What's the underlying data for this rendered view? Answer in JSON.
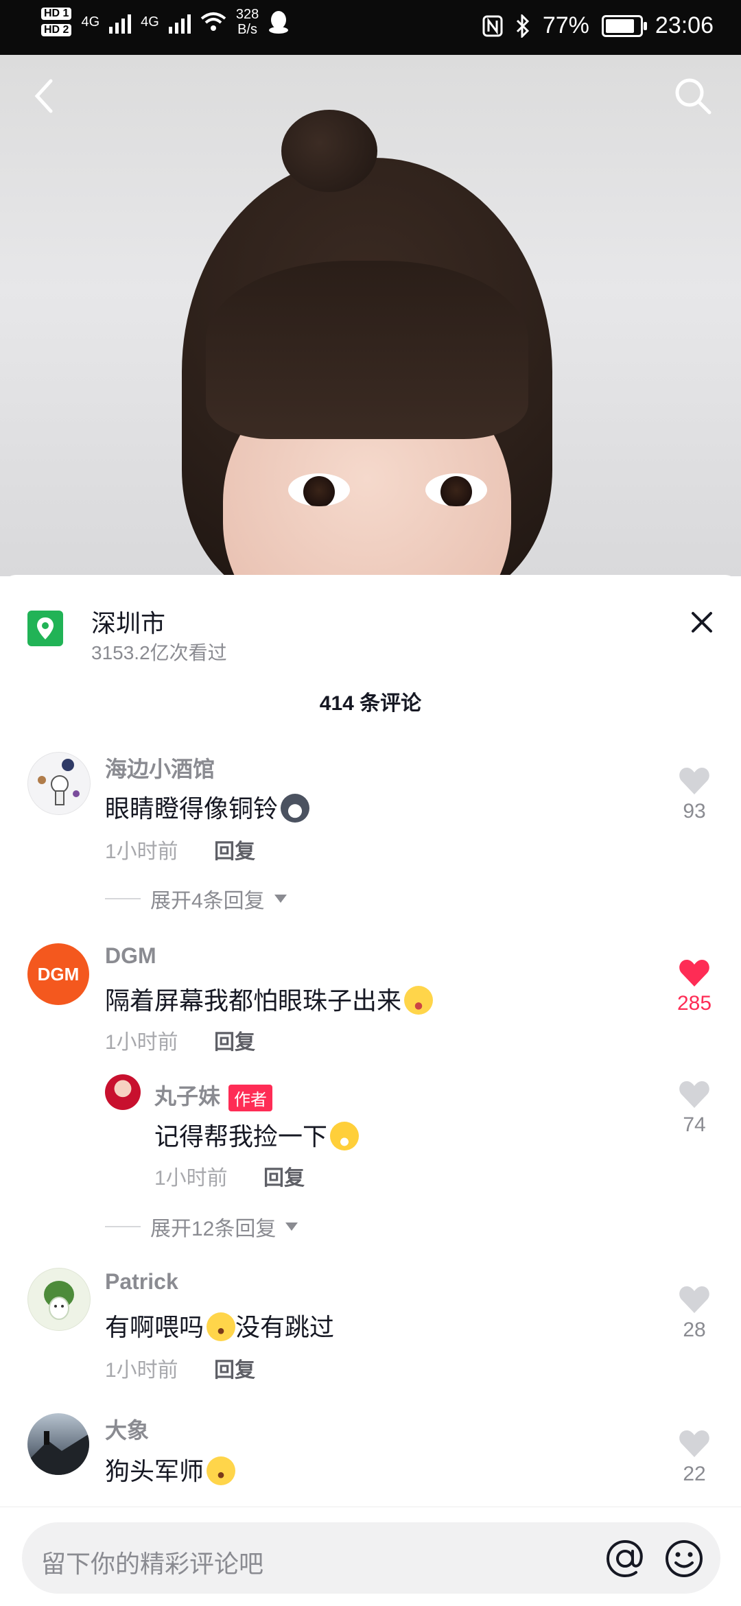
{
  "status_bar": {
    "net_speed": "328",
    "net_unit": "B/s",
    "battery": "77%",
    "time": "23:06",
    "sim1": "HD 1",
    "sim2": "HD 2",
    "net1": "4G",
    "net2": "4G"
  },
  "location": {
    "name": "深圳市",
    "views": "3153.2亿次看过"
  },
  "comments_header": "414 条评论",
  "comments": [
    {
      "user": "海边小酒馆",
      "text": "眼睛瞪得像铜铃",
      "time": "1小时前",
      "reply_label": "回复",
      "likes": "93",
      "expand": "展开4条回复"
    },
    {
      "user": "DGM",
      "avatar_text": "DGM",
      "text": "隔着屏幕我都怕眼珠子出来",
      "time": "1小时前",
      "reply_label": "回复",
      "likes": "285",
      "liked": true
    },
    {
      "user": "丸子妹",
      "badge": "作者",
      "text": "记得帮我捡一下",
      "time": "1小时前",
      "reply_label": "回复",
      "likes": "74",
      "expand": "展开12条回复"
    },
    {
      "user": "Patrick",
      "text": "有啊喂吗",
      "text2": "没有跳过",
      "time": "1小时前",
      "reply_label": "回复",
      "likes": "28"
    },
    {
      "user": "大象",
      "text": "狗头军师",
      "likes": "22"
    }
  ],
  "input": {
    "placeholder": "留下你的精彩评论吧"
  },
  "colors": {
    "accent": "#fe2c55",
    "location": "#21b356",
    "dgm_avatar": "#f4581e"
  }
}
